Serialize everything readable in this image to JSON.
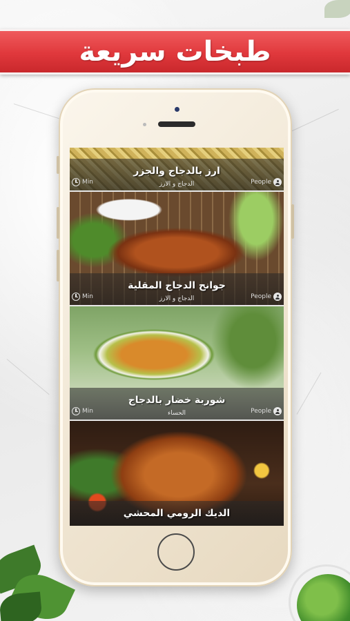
{
  "banner": {
    "title": "طبخات سريعة"
  },
  "recipes": [
    {
      "title": "ارز بالدجاج والجزر",
      "category": "الدجاج و الارز",
      "time_label": "Min",
      "people_label": "People"
    },
    {
      "title": "جوانح الدجاج المقلية",
      "category": "الدجاج و الارز",
      "time_label": "Min",
      "people_label": "People"
    },
    {
      "title": "شوربة خضار بالدجاج",
      "category": "الحساء",
      "time_label": "Min",
      "people_label": "People"
    },
    {
      "title": "الديك الرومي المحشي",
      "category": "",
      "time_label": "",
      "people_label": ""
    }
  ],
  "icons": {
    "time": "clock-icon",
    "people": "person-icon"
  },
  "colors": {
    "banner_red": "#e0383c",
    "phone_gold": "#f1e7d5",
    "overlay": "#2a2a2a"
  }
}
